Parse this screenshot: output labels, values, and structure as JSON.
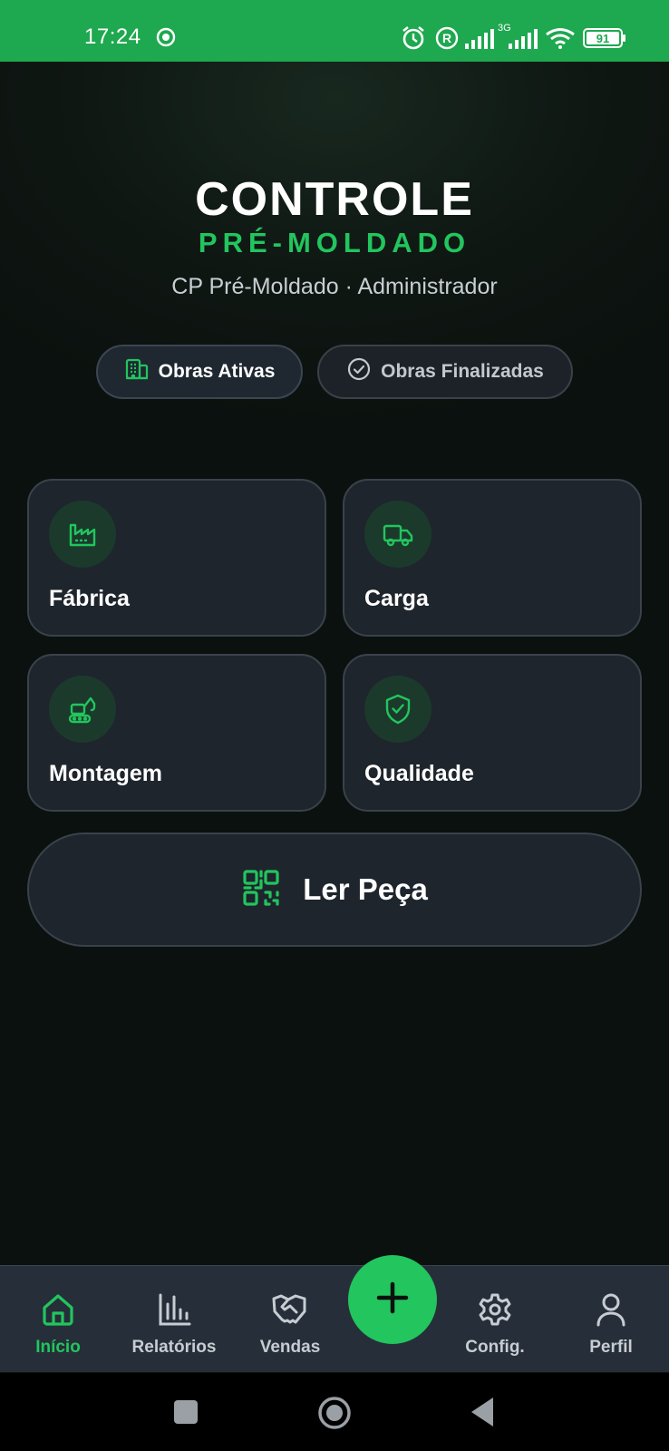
{
  "status_bar": {
    "time": "17:24",
    "battery": "91",
    "network": "3G"
  },
  "header": {
    "title": "CONTROLE",
    "subtitle": "PRÉ-MOLDADO",
    "meta": "CP Pré-Moldado · Administrador"
  },
  "filters": {
    "active_label": "Obras Ativas",
    "inactive_label": "Obras Finalizadas",
    "selected": "Obras Ativas"
  },
  "modules": [
    {
      "label": "Fábrica",
      "icon": "factory-icon"
    },
    {
      "label": "Carga",
      "icon": "truck-icon"
    },
    {
      "label": "Montagem",
      "icon": "excavator-icon"
    },
    {
      "label": "Qualidade",
      "icon": "shield-check-icon"
    }
  ],
  "scan_button": {
    "label": "Ler Peça",
    "icon": "qr-code-icon"
  },
  "bottom_nav": [
    {
      "label": "Início",
      "icon": "home-icon",
      "active": true
    },
    {
      "label": "Relatórios",
      "icon": "bar-chart-icon",
      "active": false
    },
    {
      "label": "Vendas",
      "icon": "handshake-icon",
      "active": false
    },
    {
      "label": "Config.",
      "icon": "gear-icon",
      "active": false
    },
    {
      "label": "Perfil",
      "icon": "user-icon",
      "active": false
    }
  ],
  "fab": {
    "icon": "plus-icon"
  },
  "colors": {
    "accent": "#22c55e",
    "status_bar": "#1ea84f",
    "card": "#1f252c",
    "nav_bg": "#262f39"
  }
}
